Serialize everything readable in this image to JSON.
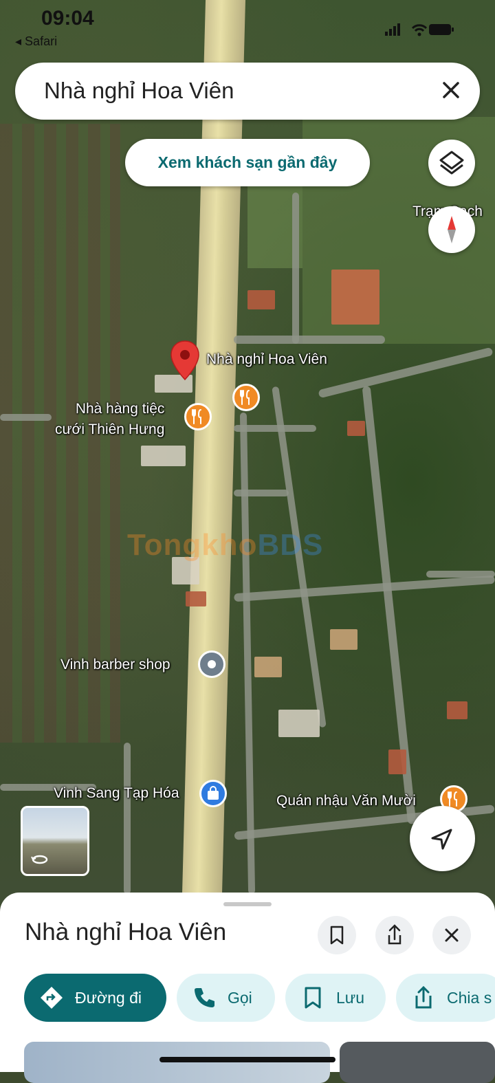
{
  "status_bar": {
    "time": "09:04",
    "back_app": "Safari"
  },
  "search": {
    "query": "Nhà nghỉ Hoa Viên"
  },
  "chip": {
    "label": "Xem khách sạn gần đây"
  },
  "map": {
    "partial_label": "Trạm Sạch",
    "labels": {
      "selected_place": "Nhà nghỉ Hoa Viên",
      "restaurant_1": "Nhà hàng tiệc\ncưới Thiên Hưng",
      "barber": "Vinh barber shop",
      "grocery": "Vinh Sang Tạp Hóa",
      "pub": "Quán nhậu Văn Mười"
    },
    "watermark": {
      "part1": "Tongkho",
      "part2": "BDS"
    }
  },
  "sheet": {
    "title": "Nhà nghỉ Hoa Viên",
    "actions": {
      "directions": "Đường đi",
      "call": "Gọi",
      "save": "Lưu",
      "share": "Chia s"
    }
  },
  "colors": {
    "accent": "#0b6a70",
    "accent_light": "#dff3f5",
    "pin_red": "#e53935",
    "poi_orange": "#f08a24",
    "poi_blue": "#2f7be0"
  }
}
